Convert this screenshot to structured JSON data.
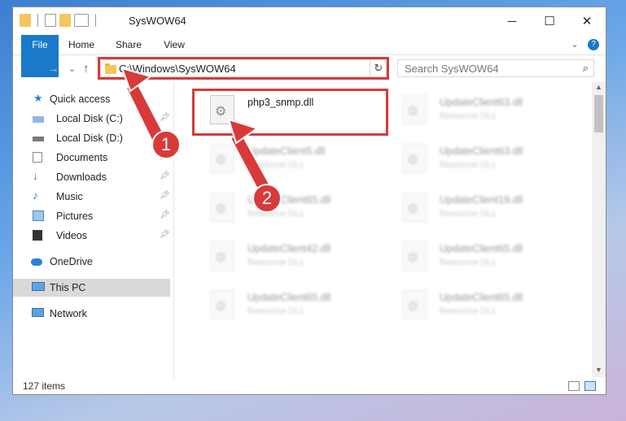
{
  "window": {
    "title": "SysWOW64",
    "controls": {
      "minimize": "─",
      "maximize": "☐",
      "close": "✕"
    }
  },
  "ribbon": {
    "tabs": [
      "File",
      "Home",
      "Share",
      "View"
    ]
  },
  "nav": {
    "back": "←",
    "forward": "→",
    "recent": "⌄",
    "up": "↑",
    "address": "C:\\Windows\\SysWOW64",
    "refresh": "↻",
    "search_placeholder": "Search SysWOW64"
  },
  "sidebar": {
    "quick_access": "Quick access",
    "items": [
      {
        "label": "Local Disk (C:)",
        "pinned": true
      },
      {
        "label": "Local Disk (D:)",
        "pinned": false
      },
      {
        "label": "Documents",
        "pinned": true
      },
      {
        "label": "Downloads",
        "pinned": true
      },
      {
        "label": "Music",
        "pinned": true
      },
      {
        "label": "Pictures",
        "pinned": true
      },
      {
        "label": "Videos",
        "pinned": true
      }
    ],
    "onedrive": "OneDrive",
    "this_pc": "This PC",
    "network": "Network"
  },
  "files": [
    {
      "name": "php3_snmp.dll",
      "type": ""
    },
    {
      "name": "UpdateClient63.dll",
      "type": "Resource DLL"
    },
    {
      "name": "UpdateClient5.dll",
      "type": "Resource DLL"
    },
    {
      "name": "UpdateClient63.dll",
      "type": "Resource DLL"
    },
    {
      "name": "UpdateClient65.dll",
      "type": "Resource DLL"
    },
    {
      "name": "UpdateClient19.dll",
      "type": "Resource DLL"
    },
    {
      "name": "UpdateClient42.dll",
      "type": "Resource DLL"
    },
    {
      "name": "UpdateClient65.dll",
      "type": "Resource DLL"
    },
    {
      "name": "UpdateClient65.dll",
      "type": "Resource DLL"
    },
    {
      "name": "UpdateClient65.dll",
      "type": "Resource DLL"
    }
  ],
  "status": {
    "count": "127 items"
  },
  "annotations": {
    "step1": "1",
    "step2": "2"
  },
  "colors": {
    "accent": "#1979ca",
    "highlight": "#d83a3a",
    "selection": "#d9d9d9"
  }
}
